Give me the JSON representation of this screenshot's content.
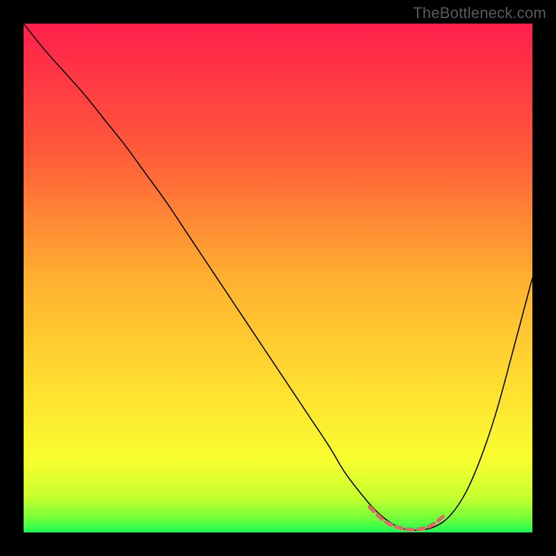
{
  "watermark": "TheBottleneck.com",
  "chart_data": {
    "type": "line",
    "title": "",
    "xlabel": "",
    "ylabel": "",
    "xlim": [
      0,
      100
    ],
    "ylim": [
      0,
      100
    ],
    "grid": false,
    "legend": false,
    "background_gradient": {
      "stops": [
        {
          "offset": 0.0,
          "color": "#ff1f4b"
        },
        {
          "offset": 0.25,
          "color": "#ff5a3a"
        },
        {
          "offset": 0.5,
          "color": "#ffb030"
        },
        {
          "offset": 0.72,
          "color": "#ffe030"
        },
        {
          "offset": 0.86,
          "color": "#f7ff2f"
        },
        {
          "offset": 0.93,
          "color": "#c8ff2f"
        },
        {
          "offset": 0.97,
          "color": "#78ff3a"
        },
        {
          "offset": 1.0,
          "color": "#1aff55"
        }
      ]
    },
    "series": [
      {
        "name": "bottleneck-curve",
        "color": "#000000",
        "stroke_width": 1.6,
        "x": [
          0,
          4,
          8,
          12,
          16,
          20,
          24,
          28,
          32,
          36,
          40,
          44,
          48,
          52,
          56,
          60,
          63,
          66,
          69,
          72,
          75,
          78,
          81,
          84,
          87,
          90,
          93,
          96,
          100
        ],
        "y": [
          100,
          95,
          90.5,
          86,
          81,
          76,
          70.5,
          65,
          59,
          53,
          47,
          41,
          35,
          29,
          23,
          17,
          12,
          8,
          4.5,
          2,
          0.6,
          0.5,
          1.2,
          3.5,
          8,
          15,
          24,
          35,
          50
        ]
      },
      {
        "name": "minimum-band",
        "color": "#e06a6a",
        "stroke_width": 5.5,
        "dash": "9 7",
        "x": [
          68,
          71,
          74,
          77,
          80,
          83
        ],
        "y": [
          5.0,
          2.2,
          0.9,
          0.6,
          1.3,
          3.6
        ]
      }
    ]
  }
}
